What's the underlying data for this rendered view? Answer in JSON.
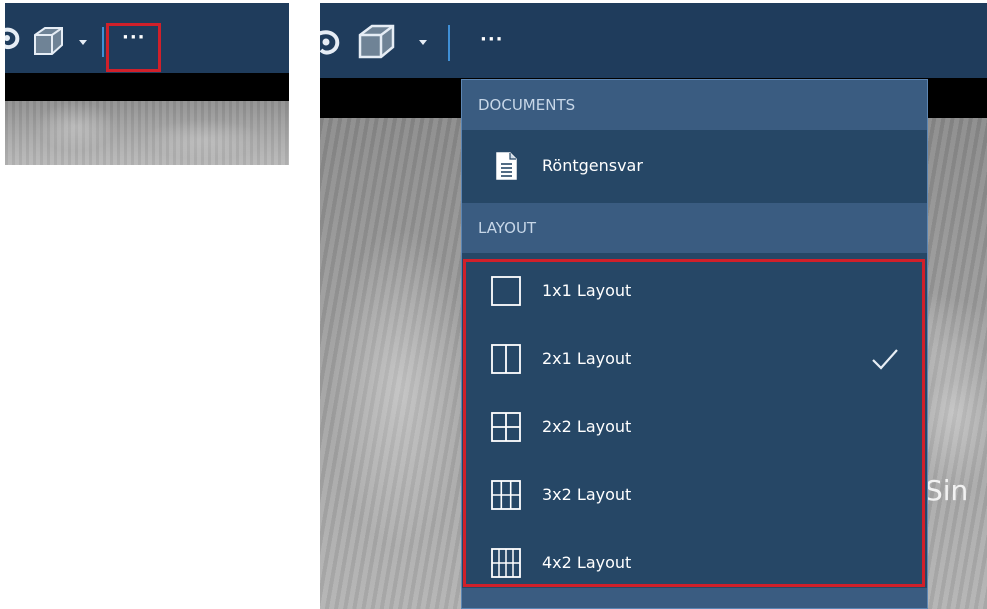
{
  "toolbar": {
    "more_label": "···",
    "icons": [
      "rotate-icon",
      "cube-icon",
      "chevron-down-icon",
      "more-icon"
    ]
  },
  "menu": {
    "sections": [
      {
        "header": "DOCUMENTS",
        "items": [
          {
            "label": "Röntgensvar",
            "icon": "document-icon"
          }
        ]
      },
      {
        "header": "LAYOUT",
        "items": [
          {
            "label": "1x1 Layout",
            "icon": "layout-1x1-icon",
            "checked": false
          },
          {
            "label": "2x1 Layout",
            "icon": "layout-2x1-icon",
            "checked": true
          },
          {
            "label": "2x2 Layout",
            "icon": "layout-2x2-icon",
            "checked": false
          },
          {
            "label": "3x2 Layout",
            "icon": "layout-3x2-icon",
            "checked": false
          },
          {
            "label": "4x2 Layout",
            "icon": "layout-4x2-icon",
            "checked": false
          }
        ]
      }
    ]
  },
  "viewer": {
    "overlay_text": "Sin"
  },
  "colors": {
    "toolbar_bg": "#1f3c5c",
    "menu_bg": "#264766",
    "section_header_bg": "#3a5c81",
    "highlight_red": "#d0202a",
    "separator_blue": "#3f8fd6"
  }
}
